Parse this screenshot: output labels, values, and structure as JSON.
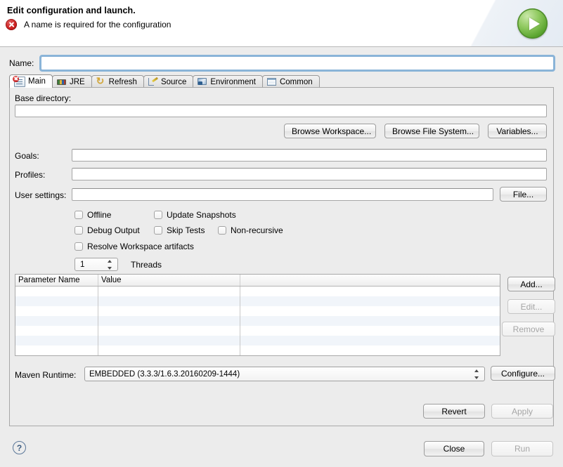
{
  "header": {
    "title": "Edit configuration and launch.",
    "error_message": "A name is required for the configuration",
    "error_icon": "error-circle-x-icon",
    "run_icon": "green-run-play-icon"
  },
  "name_row": {
    "label": "Name:",
    "value": "",
    "placeholder": ""
  },
  "tabs": [
    {
      "label": "Main",
      "icon": "main-document-error-icon",
      "active": true
    },
    {
      "label": "JRE",
      "icon": "jre-books-icon",
      "active": false
    },
    {
      "label": "Refresh",
      "icon": "refresh-arrows-icon",
      "active": false
    },
    {
      "label": "Source",
      "icon": "source-tree-pencil-icon",
      "active": false
    },
    {
      "label": "Environment",
      "icon": "environment-icon",
      "active": false
    },
    {
      "label": "Common",
      "icon": "common-table-icon",
      "active": false
    }
  ],
  "main": {
    "base_directory": {
      "label": "Base directory:",
      "value": ""
    },
    "browse_buttons": [
      {
        "label": "Browse Workspace...",
        "enabled": true
      },
      {
        "label": "Browse File System...",
        "enabled": true
      },
      {
        "label": "Variables...",
        "enabled": true
      }
    ],
    "fields": [
      {
        "label": "Goals:",
        "value": ""
      },
      {
        "label": "Profiles:",
        "value": ""
      }
    ],
    "user_settings": {
      "label": "User settings:",
      "value": "",
      "button": "File..."
    },
    "checkboxes": [
      {
        "label": "Offline",
        "checked": false
      },
      {
        "label": "Update Snapshots",
        "checked": false
      },
      {
        "label": "Debug Output",
        "checked": false
      },
      {
        "label": "Skip Tests",
        "checked": false
      },
      {
        "label": "Non-recursive",
        "checked": false
      },
      {
        "label": "Resolve Workspace artifacts",
        "checked": false
      }
    ],
    "threads": {
      "value": "1",
      "label": "Threads"
    },
    "parameters_table": {
      "columns": [
        "Parameter Name",
        "Value",
        ""
      ],
      "rows": []
    },
    "table_buttons": [
      {
        "label": "Add...",
        "enabled": true
      },
      {
        "label": "Edit...",
        "enabled": false
      },
      {
        "label": "Remove",
        "enabled": false
      }
    ],
    "maven_runtime": {
      "label": "Maven Runtime:",
      "selected": "EMBEDDED (3.3.3/1.6.3.20160209-1444)",
      "button": "Configure..."
    },
    "apply_buttons": [
      {
        "label": "Revert",
        "enabled": true
      },
      {
        "label": "Apply",
        "enabled": false
      }
    ]
  },
  "footer": {
    "help_icon": "?",
    "buttons": [
      {
        "label": "Close",
        "enabled": true
      },
      {
        "label": "Run",
        "enabled": false
      }
    ]
  }
}
